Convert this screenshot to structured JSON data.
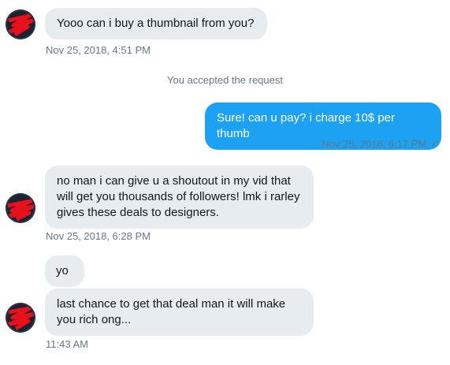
{
  "colors": {
    "incoming_bubble": "#e6ecf0",
    "outgoing_bubble": "#1da1f2",
    "timestamp": "#657786",
    "text": "#14171a"
  },
  "messages": [
    {
      "direction": "incoming",
      "text": "Yooo can i buy a thumbnail from you?",
      "time": "Nov 25, 2018, 4:51 PM"
    },
    {
      "direction": "outgoing",
      "text": "Sure! can u pay? i charge 10$ per thumb",
      "time": "Nov 25, 2018, 6:17 PM"
    },
    {
      "direction": "incoming",
      "text": "no man i can give u a shoutout in my vid that will get you thousands of followers! lmk i rarley gives these deals to designers.",
      "time": "Nov 25, 2018, 6:28 PM"
    },
    {
      "direction": "incoming",
      "text": "yo"
    },
    {
      "direction": "incoming",
      "text": "last chance to get that deal man it will make you rich ong...",
      "time": "11:43 AM"
    }
  ],
  "system_notice": "You accepted the request",
  "read_receipt_icon": "check-icon"
}
